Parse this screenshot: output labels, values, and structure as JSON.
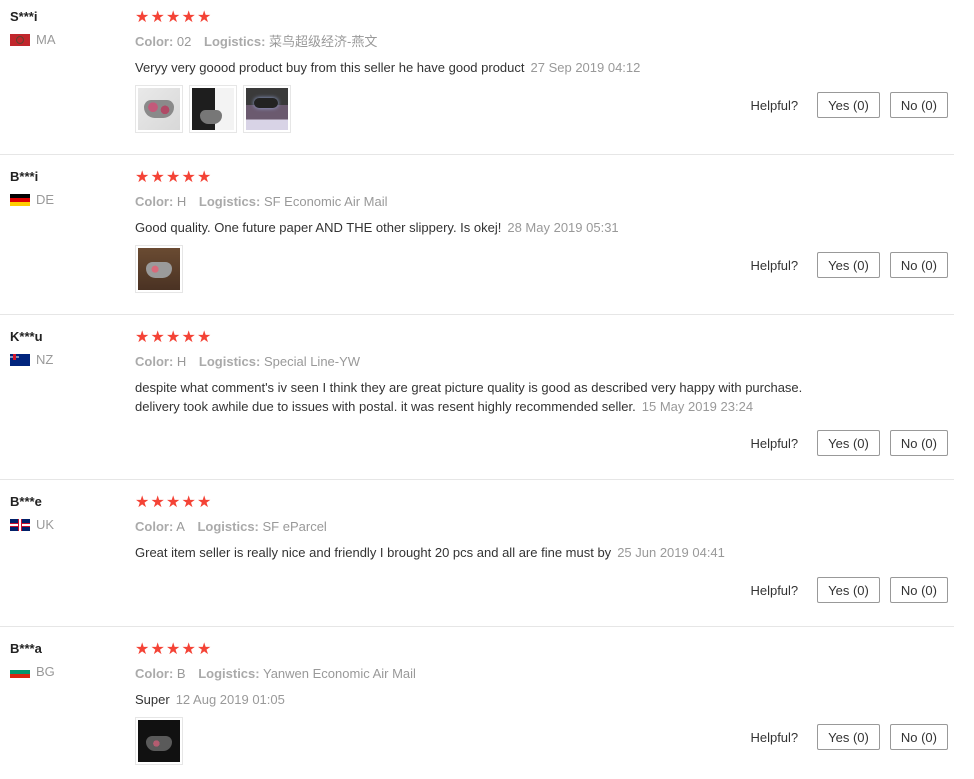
{
  "ui": {
    "color_key": "Color:",
    "logistics_key": "Logistics:",
    "helpful_label": "Helpful?"
  },
  "reviews": [
    {
      "user": "S***i",
      "country_code": "MA",
      "flag": "flag-ma",
      "rating": 5,
      "color": "02",
      "logistics": "菜鸟超级经济-燕文",
      "text": "Veryy very goood product buy from this seller he have good product",
      "date": "27 Sep 2019 04:12",
      "photos": [
        "controller-photo-pink",
        "console-photo",
        "controller-light-photo"
      ],
      "yes": "Yes (0)",
      "no": "No (0)"
    },
    {
      "user": "B***i",
      "country_code": "DE",
      "flag": "flag-de",
      "rating": 5,
      "color": "H",
      "logistics": "SF Economic Air Mail",
      "text": "Good quality. One future paper AND THE other slippery. Is okej!",
      "date": "28 May 2019 05:31",
      "photos": [
        "controller-photo-wood"
      ],
      "yes": "Yes (0)",
      "no": "No (0)"
    },
    {
      "user": "K***u",
      "country_code": "NZ",
      "flag": "flag-nz",
      "rating": 5,
      "color": "H",
      "logistics": "Special Line-YW",
      "text": "despite what comment's iv seen I think they are great picture quality is good as described very happy with purchase. delivery took awhile due to issues with postal. it was resent highly recommended seller.",
      "date": "15 May 2019 23:24",
      "photos": [],
      "yes": "Yes (0)",
      "no": "No (0)"
    },
    {
      "user": "B***e",
      "country_code": "UK",
      "flag": "flag-uk",
      "rating": 5,
      "color": "A",
      "logistics": "SF eParcel",
      "text": "Great item seller is really nice and friendly I brought 20 pcs and all are fine must by",
      "date": "25 Jun 2019 04:41",
      "photos": [],
      "yes": "Yes (0)",
      "no": "No (0)"
    },
    {
      "user": "B***a",
      "country_code": "BG",
      "flag": "flag-bg",
      "rating": 5,
      "color": "B",
      "logistics": "Yanwen Economic Air Mail",
      "text": "Super",
      "date": "12 Aug 2019 01:05",
      "photos": [
        "controller-photo-dark"
      ],
      "yes": "Yes (0)",
      "no": "No (0)"
    }
  ]
}
